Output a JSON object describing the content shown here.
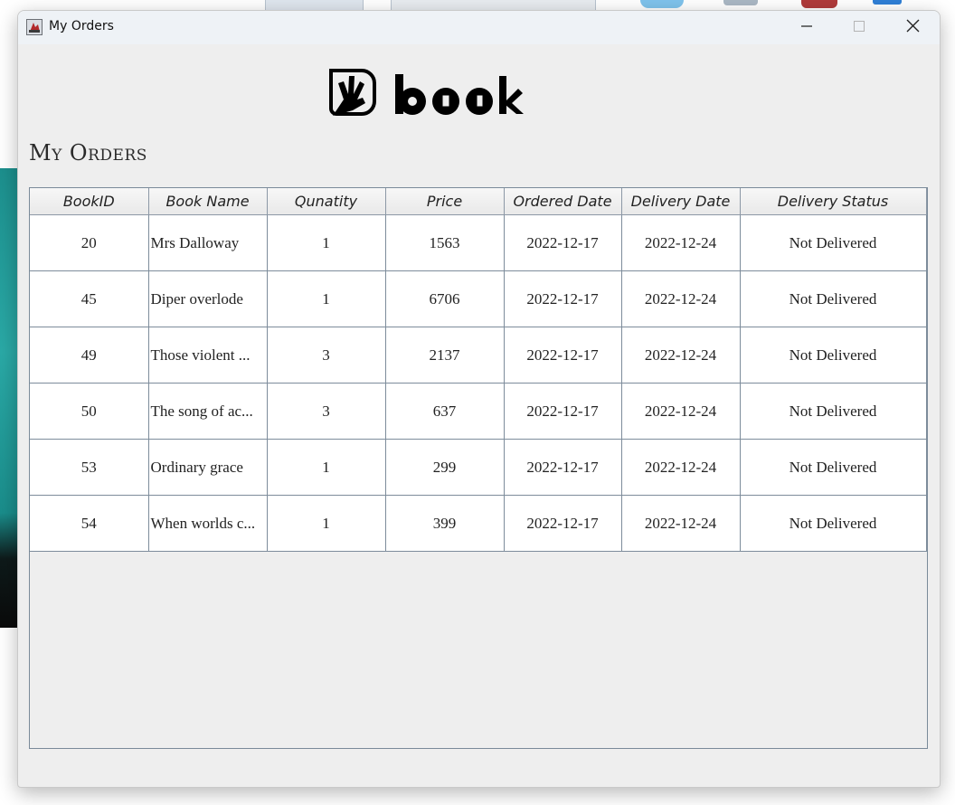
{
  "window": {
    "title": "My Orders"
  },
  "brand": {
    "logo_text": "book"
  },
  "page": {
    "heading": "My Orders"
  },
  "table": {
    "headers": [
      "BookID",
      "Book Name",
      "Qunatity",
      "Price",
      "Ordered Date",
      "Delivery Date",
      "Delivery Status"
    ],
    "rows": [
      [
        "20",
        "Mrs Dalloway",
        "1",
        "1563",
        "2022-12-17",
        "2022-12-24",
        "Not Delivered"
      ],
      [
        "45",
        "Diper overlode",
        "1",
        "6706",
        "2022-12-17",
        "2022-12-24",
        "Not Delivered"
      ],
      [
        "49",
        "Those violent ...",
        "3",
        "2137",
        "2022-12-17",
        "2022-12-24",
        "Not Delivered"
      ],
      [
        "50",
        "The song of ac...",
        "3",
        "637",
        "2022-12-17",
        "2022-12-24",
        "Not Delivered"
      ],
      [
        "53",
        "Ordinary grace",
        "1",
        "299",
        "2022-12-17",
        "2022-12-24",
        "Not Delivered"
      ],
      [
        "54",
        "When worlds c...",
        "1",
        "399",
        "2022-12-17",
        "2022-12-24",
        "Not Delivered"
      ]
    ]
  },
  "icons": {
    "app": "java-app-icon",
    "minimize": "minimize-icon",
    "maximize": "maximize-icon",
    "close": "close-icon"
  },
  "colors": {
    "window_bg": "#eeeeee",
    "titlebar_bg": "#eef2f6",
    "grid_line": "#7d8c9b",
    "cell_bg": "#ffffff"
  }
}
